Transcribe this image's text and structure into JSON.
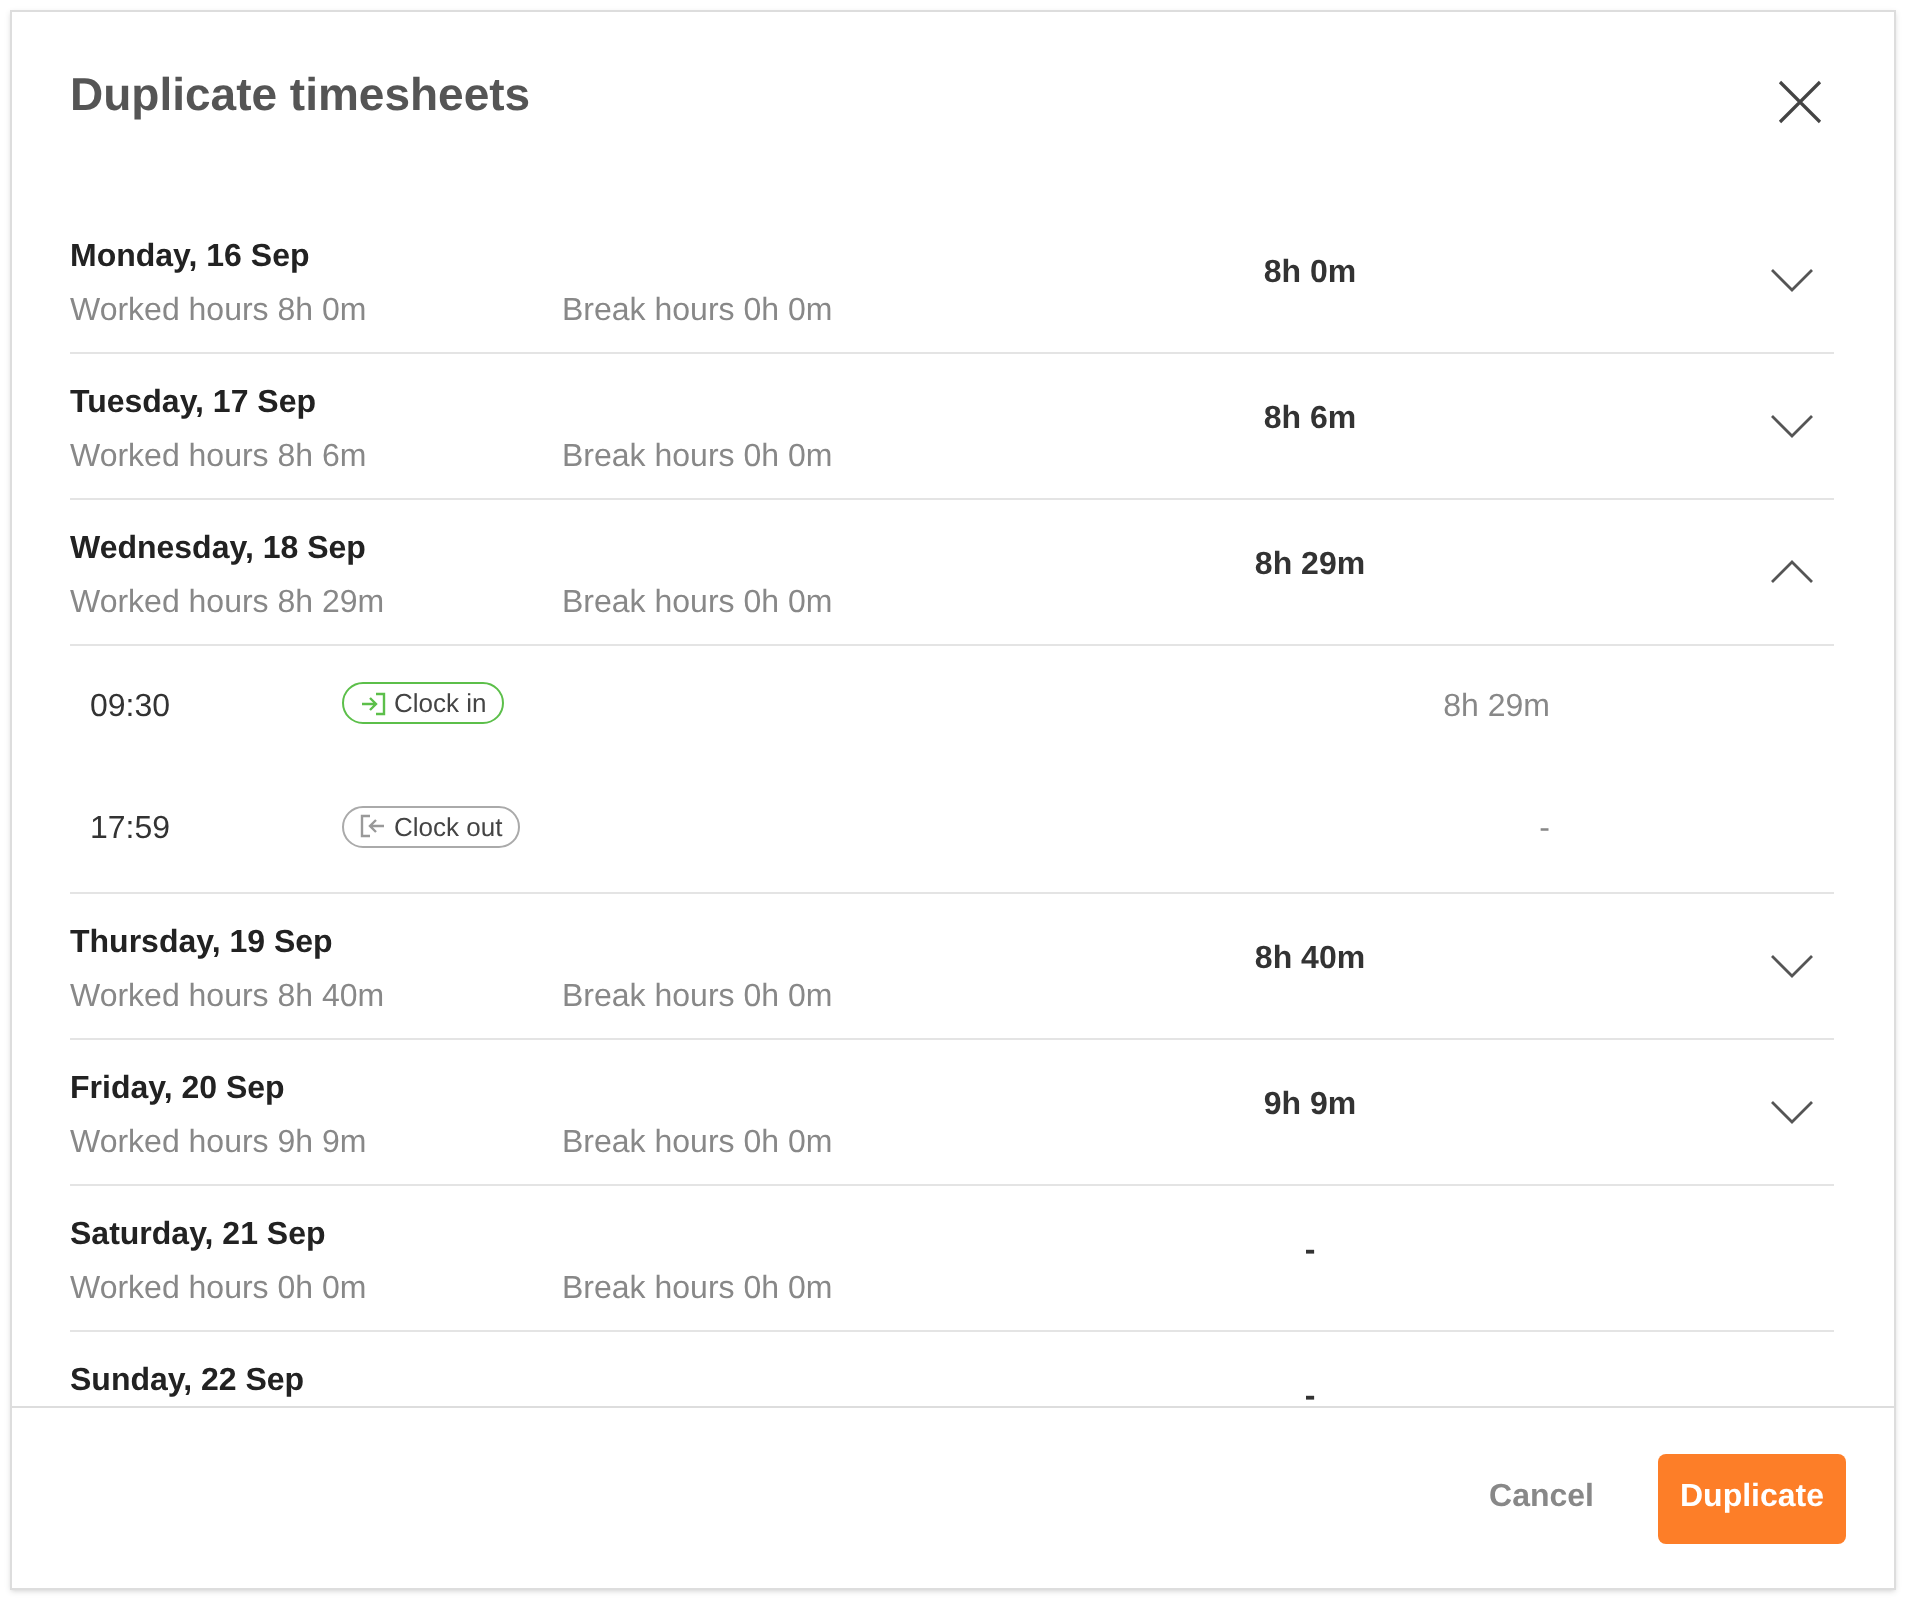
{
  "dialog": {
    "title": "Duplicate timesheets"
  },
  "days": [
    {
      "date": "Monday, 16 Sep",
      "worked": "Worked hours 8h 0m",
      "break": "Break hours 0h 0m",
      "total": "8h 0m",
      "expanded": false
    },
    {
      "date": "Tuesday, 17 Sep",
      "worked": "Worked hours 8h 6m",
      "break": "Break hours 0h 0m",
      "total": "8h 6m",
      "expanded": false
    },
    {
      "date": "Wednesday, 18 Sep",
      "worked": "Worked hours 8h 29m",
      "break": "Break hours 0h 0m",
      "total": "8h 29m",
      "expanded": true,
      "entries": [
        {
          "time": "09:30",
          "kind": "clock_in",
          "label": "Clock in",
          "duration": "8h 29m"
        },
        {
          "time": "17:59",
          "kind": "clock_out",
          "label": "Clock out",
          "duration": "-"
        }
      ]
    },
    {
      "date": "Thursday, 19 Sep",
      "worked": "Worked hours 8h 40m",
      "break": "Break hours 0h 0m",
      "total": "8h 40m",
      "expanded": false
    },
    {
      "date": "Friday, 20 Sep",
      "worked": "Worked hours 9h 9m",
      "break": "Break hours 0h 0m",
      "total": "9h 9m",
      "expanded": false
    },
    {
      "date": "Saturday, 21 Sep",
      "worked": "Worked hours 0h 0m",
      "break": "Break hours 0h 0m",
      "total": "-"
    },
    {
      "date": "Sunday, 22 Sep",
      "total": "-"
    }
  ],
  "footer": {
    "cancel": "Cancel",
    "confirm": "Duplicate"
  }
}
